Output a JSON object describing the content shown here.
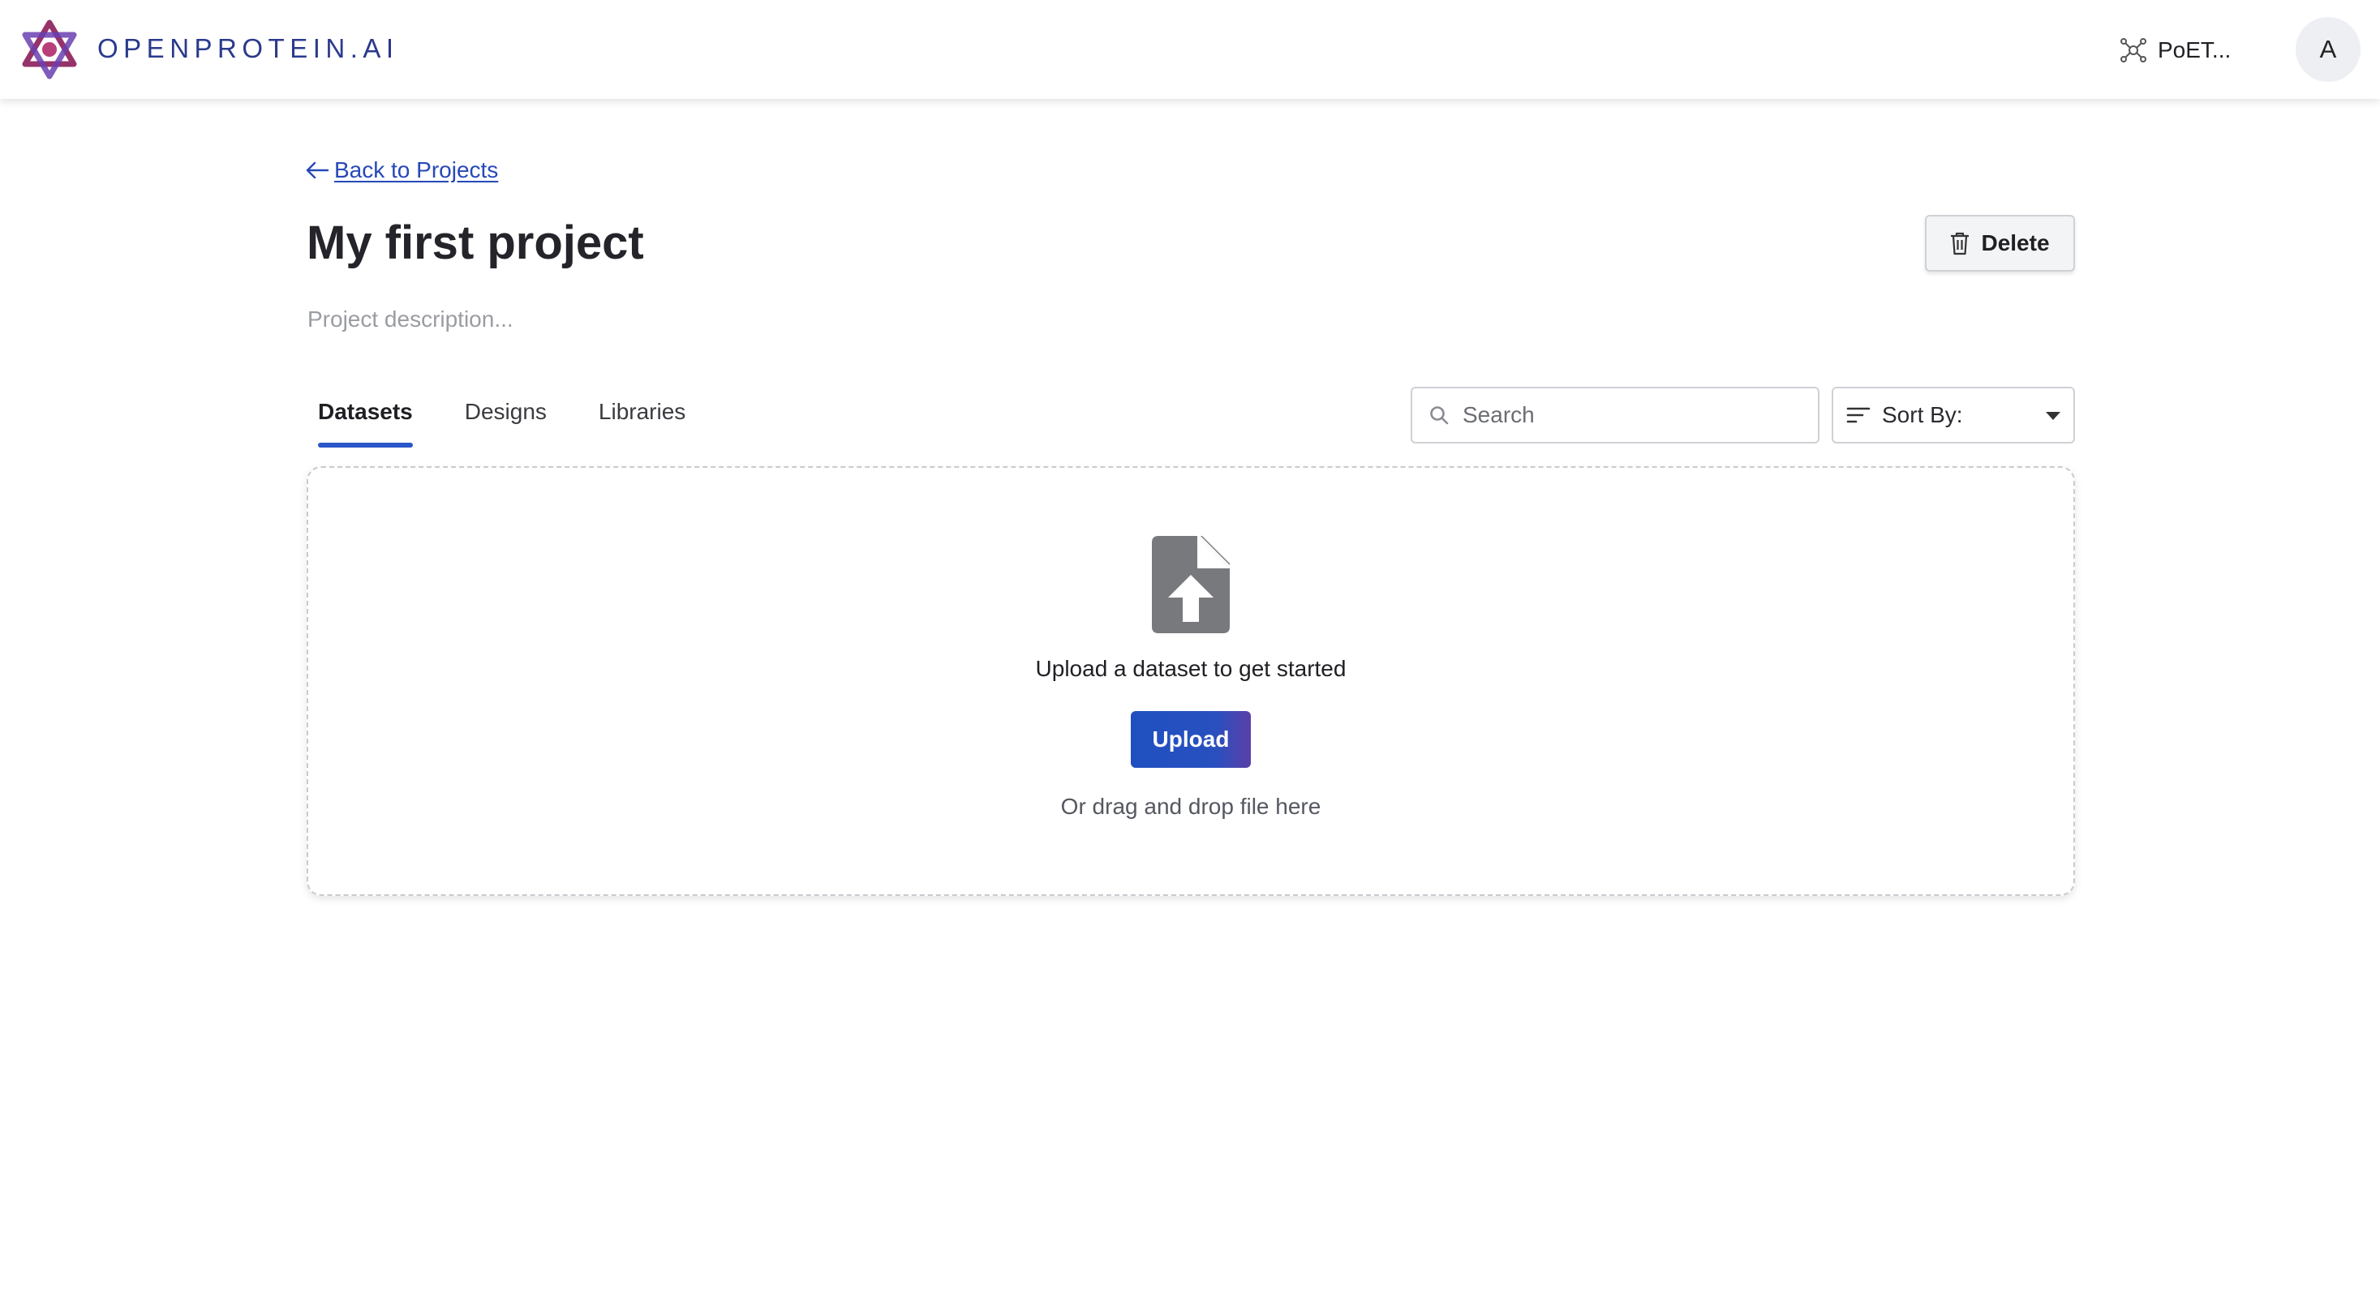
{
  "app": {
    "brand": "OPENPROTEIN.AI",
    "model_selector_label": "PoET...",
    "user_initial": "A"
  },
  "icons": {
    "logo": "openprotein-logo-icon",
    "model": "model-node-icon",
    "avatar": "user-avatar",
    "back": "arrow-left-icon",
    "delete": "trash-icon",
    "search": "search-icon",
    "sort": "sort-lines-icon",
    "caret": "caret-down-icon",
    "upload": "file-upload-icon"
  },
  "colors": {
    "brand": "#2a3a8c",
    "link": "#2748b8",
    "accent": "#2b56c9",
    "upload_gradient_end": "#5a3fa8",
    "logo_primary": "#8b1d5a",
    "logo_secondary": "#6a3fb0"
  },
  "nav": {
    "back_label": "Back to Projects"
  },
  "project": {
    "title": "My first project",
    "description_placeholder": "Project description...",
    "delete_label": "Delete"
  },
  "tabs": {
    "datasets": "Datasets",
    "designs": "Designs",
    "libraries": "Libraries",
    "active": "Datasets"
  },
  "toolbar": {
    "search_placeholder": "Search",
    "search_value": "",
    "sort_label": "Sort By:"
  },
  "dropzone": {
    "prompt": "Upload a dataset to get started",
    "upload_label": "Upload",
    "drag_hint": "Or drag and drop file here"
  }
}
